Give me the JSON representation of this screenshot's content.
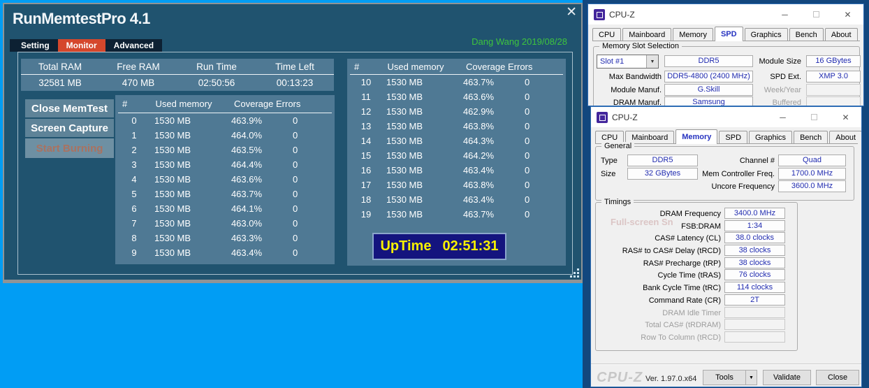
{
  "glyphs": {
    "close": "✕",
    "minimize": "─",
    "dropdown": "▼"
  },
  "memtest": {
    "title": "RunMemtestPro 4.1",
    "credit": "Dang Wang 2019/08/28",
    "tabs": [
      {
        "label": "Setting"
      },
      {
        "label": "Monitor",
        "active": true
      },
      {
        "label": "Advanced"
      }
    ],
    "summary": {
      "headers": [
        "Total RAM",
        "Free RAM",
        "Run Time",
        "Time Left"
      ],
      "values": [
        "32581 MB",
        "470 MB",
        "02:50:56",
        "00:13:23"
      ]
    },
    "buttons": [
      {
        "label": "Close MemTest",
        "enabled": true
      },
      {
        "label": "Screen Capture",
        "enabled": true
      },
      {
        "label": "Start Burning",
        "enabled": false
      }
    ],
    "table_headers": [
      "#",
      "Used memory",
      "Coverage",
      "Errors"
    ],
    "left_rows": [
      [
        "0",
        "1530 MB",
        "463.9%",
        "0"
      ],
      [
        "1",
        "1530 MB",
        "464.0%",
        "0"
      ],
      [
        "2",
        "1530 MB",
        "463.5%",
        "0"
      ],
      [
        "3",
        "1530 MB",
        "464.4%",
        "0"
      ],
      [
        "4",
        "1530 MB",
        "463.6%",
        "0"
      ],
      [
        "5",
        "1530 MB",
        "463.7%",
        "0"
      ],
      [
        "6",
        "1530 MB",
        "464.1%",
        "0"
      ],
      [
        "7",
        "1530 MB",
        "463.0%",
        "0"
      ],
      [
        "8",
        "1530 MB",
        "463.3%",
        "0"
      ],
      [
        "9",
        "1530 MB",
        "463.4%",
        "0"
      ]
    ],
    "right_rows": [
      [
        "10",
        "1530 MB",
        "463.7%",
        "0"
      ],
      [
        "11",
        "1530 MB",
        "463.6%",
        "0"
      ],
      [
        "12",
        "1530 MB",
        "462.9%",
        "0"
      ],
      [
        "13",
        "1530 MB",
        "463.8%",
        "0"
      ],
      [
        "14",
        "1530 MB",
        "464.3%",
        "0"
      ],
      [
        "15",
        "1530 MB",
        "464.2%",
        "0"
      ],
      [
        "16",
        "1530 MB",
        "463.4%",
        "0"
      ],
      [
        "17",
        "1530 MB",
        "463.8%",
        "0"
      ],
      [
        "18",
        "1530 MB",
        "463.4%",
        "0"
      ],
      [
        "19",
        "1530 MB",
        "463.7%",
        "0"
      ]
    ],
    "uptime": {
      "label": "UpTime",
      "value": "02:51:31"
    }
  },
  "cpuz_spd": {
    "window_title": "CPU-Z",
    "tabs": [
      {
        "label": "CPU"
      },
      {
        "label": "Mainboard"
      },
      {
        "label": "Memory"
      },
      {
        "label": "SPD",
        "active": true
      },
      {
        "label": "Graphics"
      },
      {
        "label": "Bench"
      },
      {
        "label": "About"
      }
    ],
    "group_title": "Memory Slot Selection",
    "slot_selected": "Slot #1",
    "slot_type": "DDR5",
    "left_fields": [
      {
        "label": "Max Bandwidth",
        "value": "DDR5-4800 (2400 MHz)"
      },
      {
        "label": "Module Manuf.",
        "value": "G.Skill"
      },
      {
        "label": "DRAM Manuf.",
        "value": "Samsung"
      }
    ],
    "right_fields": [
      {
        "label": "Module Size",
        "value": "16 GBytes"
      },
      {
        "label": "SPD Ext.",
        "value": "XMP 3.0"
      },
      {
        "label": "Week/Year",
        "value": "",
        "grayed": true
      },
      {
        "label": "Buffered",
        "value": "",
        "grayed": true
      }
    ]
  },
  "cpuz_memory": {
    "window_title": "CPU-Z",
    "tabs": [
      {
        "label": "CPU"
      },
      {
        "label": "Mainboard"
      },
      {
        "label": "Memory",
        "active": true
      },
      {
        "label": "SPD"
      },
      {
        "label": "Graphics"
      },
      {
        "label": "Bench"
      },
      {
        "label": "About"
      }
    ],
    "general": {
      "title": "General",
      "type_label": "Type",
      "type_value": "DDR5",
      "size_label": "Size",
      "size_value": "32 GBytes",
      "channel_label": "Channel #",
      "channel_value": "Quad",
      "memfreq_label": "Mem Controller Freq.",
      "memfreq_value": "1700.0 MHz",
      "uncore_label": "Uncore Frequency",
      "uncore_value": "3600.0 MHz"
    },
    "timings": {
      "title": "Timings",
      "rows": [
        {
          "label": "DRAM Frequency",
          "value": "3400.0 MHz"
        },
        {
          "label": "FSB:DRAM",
          "value": "1:34"
        },
        {
          "label": "CAS# Latency (CL)",
          "value": "38.0 clocks"
        },
        {
          "label": "RAS# to CAS# Delay (tRCD)",
          "value": "38 clocks"
        },
        {
          "label": "RAS# Precharge (tRP)",
          "value": "38 clocks"
        },
        {
          "label": "Cycle Time (tRAS)",
          "value": "76 clocks"
        },
        {
          "label": "Bank Cycle Time (tRC)",
          "value": "114 clocks"
        },
        {
          "label": "Command Rate (CR)",
          "value": "2T"
        },
        {
          "label": "DRAM Idle Timer",
          "value": "",
          "grayed": true
        },
        {
          "label": "Total CAS# (tRDRAM)",
          "value": "",
          "grayed": true
        },
        {
          "label": "Row To Column (tRCD)",
          "value": "",
          "grayed": true
        }
      ]
    },
    "ghost_text": "Full-screen Sn",
    "footer": {
      "version": "Ver. 1.97.0.x64",
      "logo": "CPU-Z",
      "tools_label": "Tools",
      "validate_label": "Validate",
      "close_label": "Close"
    }
  }
}
